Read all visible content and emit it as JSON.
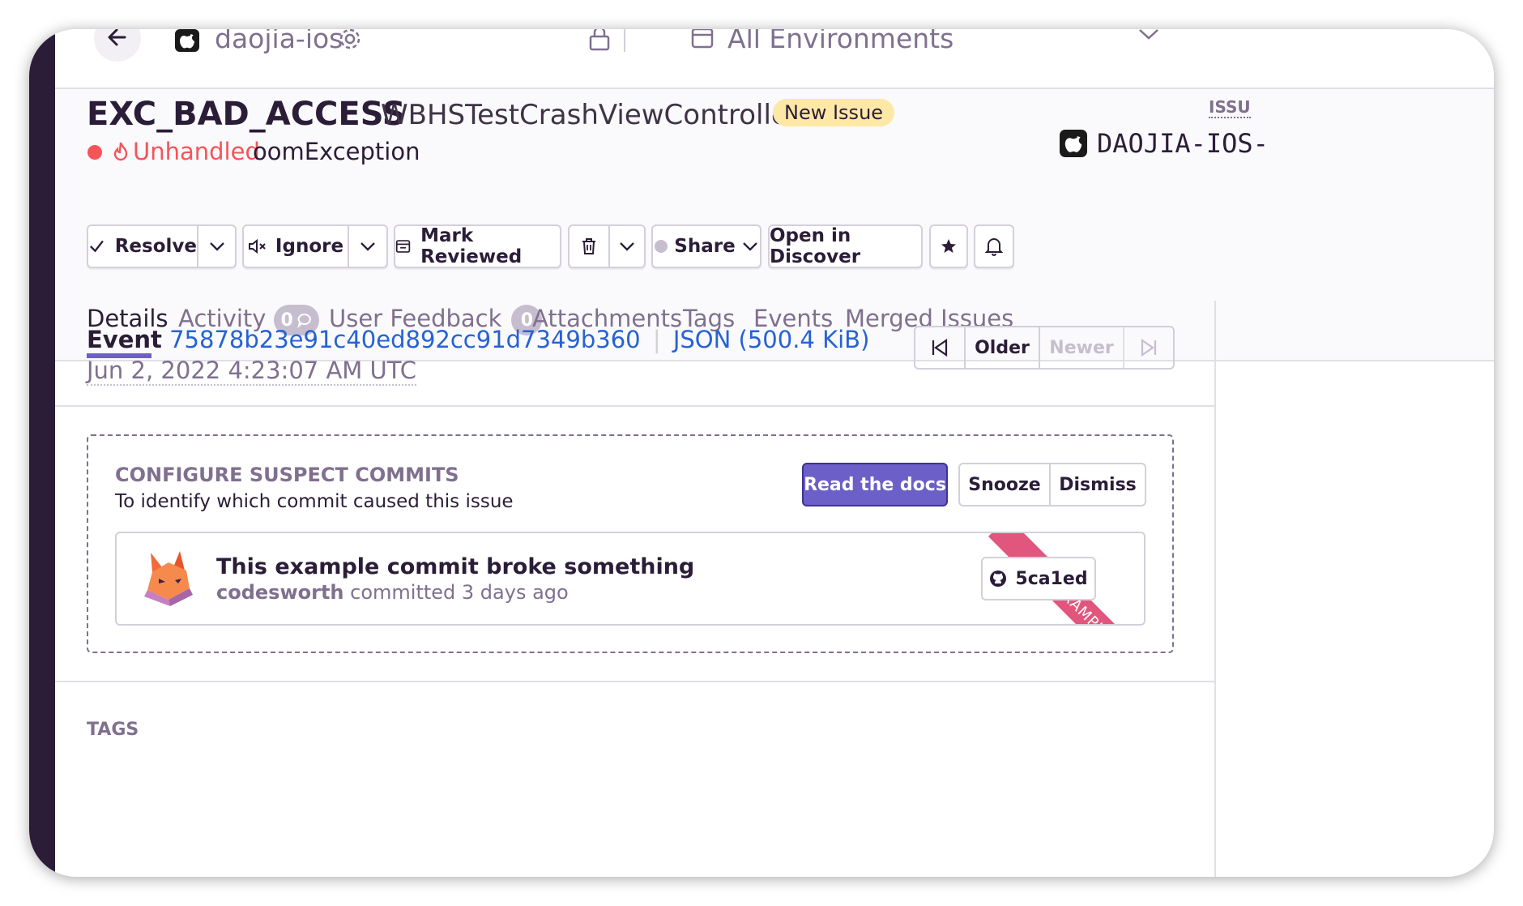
{
  "topbar": {
    "project": "daojia-ios",
    "environment": "All Environments"
  },
  "issue": {
    "title": "EXC_BAD_ACCESS",
    "subtitle": "WBHSTestCrashViewController",
    "new_badge": "New Issue",
    "unhandled": "Unhandled",
    "exception": "oomException",
    "right_label": "ISSU",
    "right_project": "DAOJIA-IOS-"
  },
  "actions": {
    "resolve": "Resolve",
    "ignore": "Ignore",
    "mark_reviewed": "Mark Reviewed",
    "share": "Share",
    "open_discover": "Open in Discover"
  },
  "tabs": {
    "details": "Details",
    "activity": "Activity",
    "activity_count": "0",
    "user_feedback": "User Feedback",
    "user_feedback_count": "0",
    "attachments": "Attachments",
    "tags": "Tags",
    "events": "Events",
    "merged": "Merged Issues"
  },
  "event": {
    "label": "Event",
    "id": "75878b23e91c40ed892cc91d7349b360",
    "json": "JSON (500.4 KiB)",
    "date": "Jun 2, 2022 4:23:07 AM UTC",
    "older": "Older",
    "newer": "Newer"
  },
  "suspect": {
    "heading": "CONFIGURE SUSPECT COMMITS",
    "subheading": "To identify which commit caused this issue",
    "read_docs": "Read the docs",
    "snooze": "Snooze",
    "dismiss": "Dismiss",
    "commit_message": "This example commit broke something",
    "author": "codesworth",
    "committed": "committed 3 days ago",
    "commit_hash": "5ca1ed",
    "ribbon": "EXAMPLE"
  },
  "tags_heading": "TAGS",
  "colors": {
    "accent": "#6c5fc7",
    "dark": "#2b1d38",
    "link": "#2562d4",
    "error": "#f55459",
    "new_badge_bg": "#fde8a5",
    "ribbon": "#e1567c"
  }
}
